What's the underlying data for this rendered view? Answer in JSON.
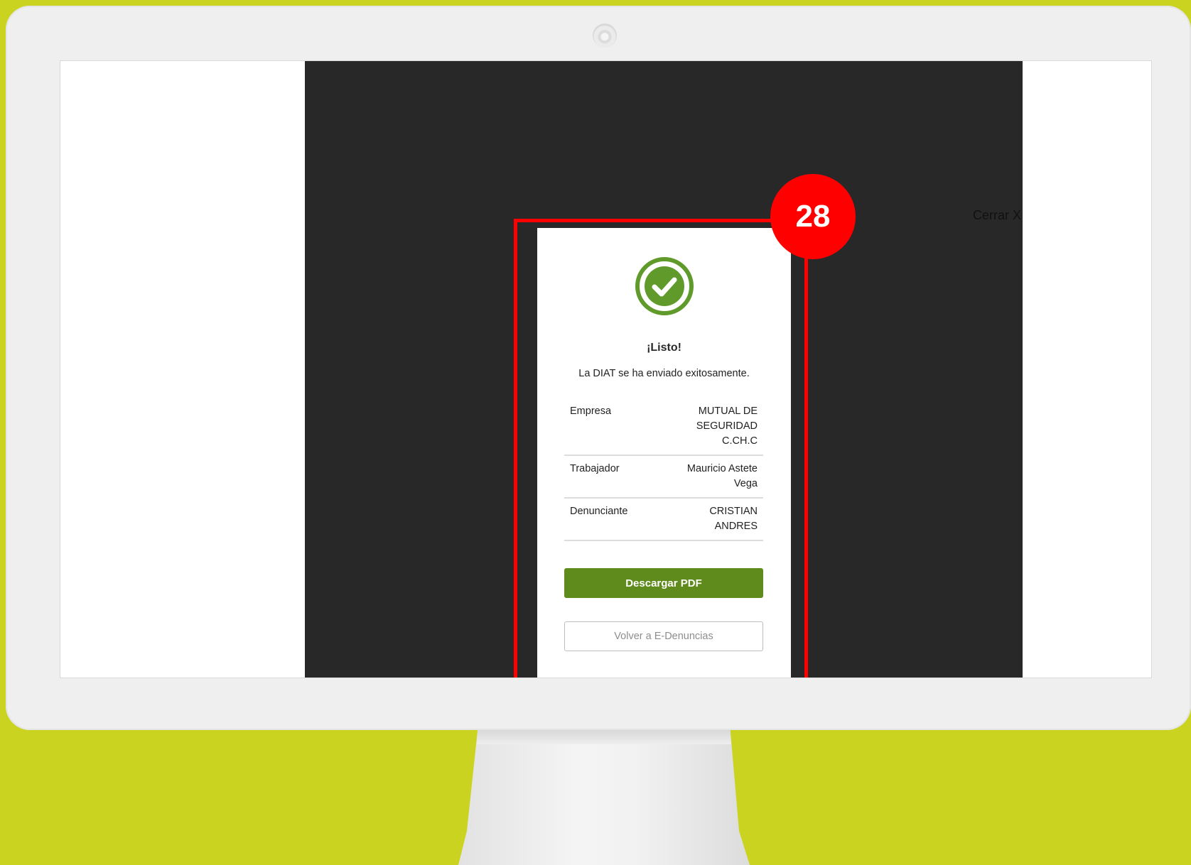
{
  "modal": {
    "close_label": "Cerrar X",
    "title": "¡Listo!",
    "subtitle": "La DIAT se ha enviado exitosamente.",
    "rows": [
      {
        "label": "Empresa",
        "value": "MUTUAL DE SEGURIDAD C.CH.C"
      },
      {
        "label": "Trabajador",
        "value": "Mauricio Astete Vega"
      },
      {
        "label": "Denunciante",
        "value": "CRISTIAN ANDRES"
      }
    ],
    "download_button": "Descargar PDF",
    "back_button": "Volver a E-Denuncias",
    "success_icon": "check-circle-icon",
    "accent_color": "#5f8a1c"
  },
  "annotation": {
    "step_number": "28",
    "color": "#ff0000"
  },
  "colors": {
    "background": "#cbd321",
    "overlay": "#282828"
  }
}
